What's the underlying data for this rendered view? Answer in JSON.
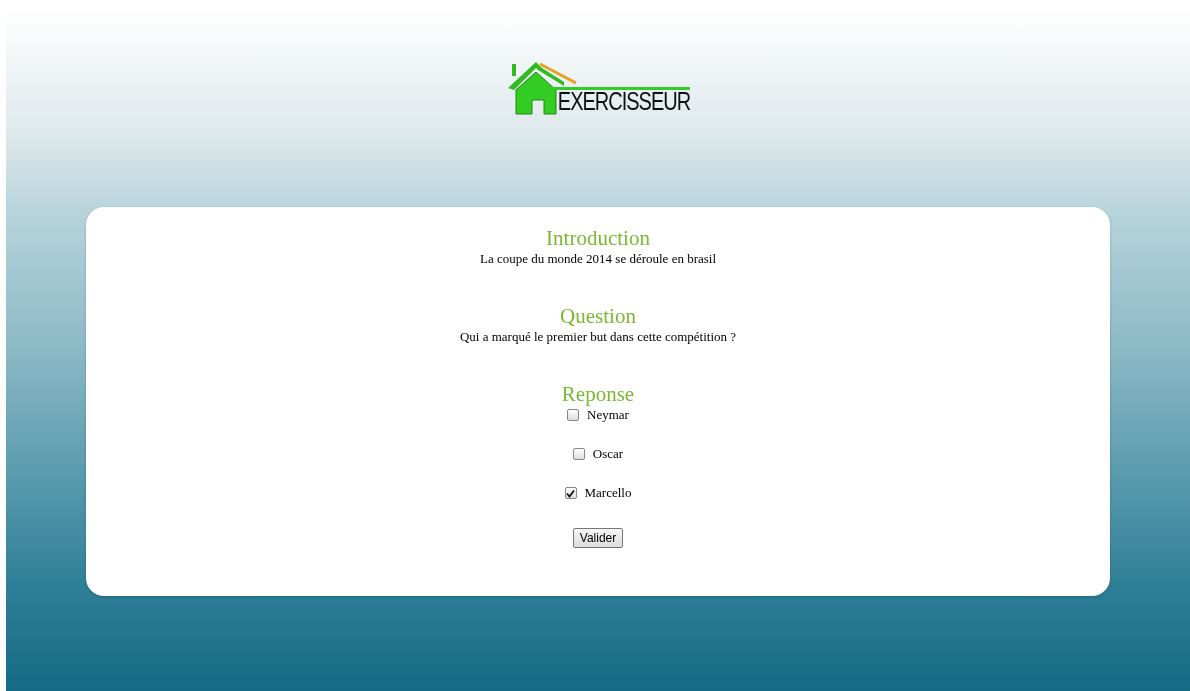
{
  "logo": {
    "text": "EXERCISSEUR"
  },
  "sections": [
    {
      "title": "Introduction",
      "text": "La coupe du monde 2014 se déroule en brasil"
    },
    {
      "title": "Question",
      "text": "Qui a marqué le premier but dans cette compétition ?"
    }
  ],
  "answer": {
    "title": "Reponse",
    "options": [
      {
        "label": "Neymar",
        "checked": false
      },
      {
        "label": "Oscar",
        "checked": false
      },
      {
        "label": "Marcello",
        "checked": true
      }
    ]
  },
  "submit": {
    "label": "Valider"
  }
}
